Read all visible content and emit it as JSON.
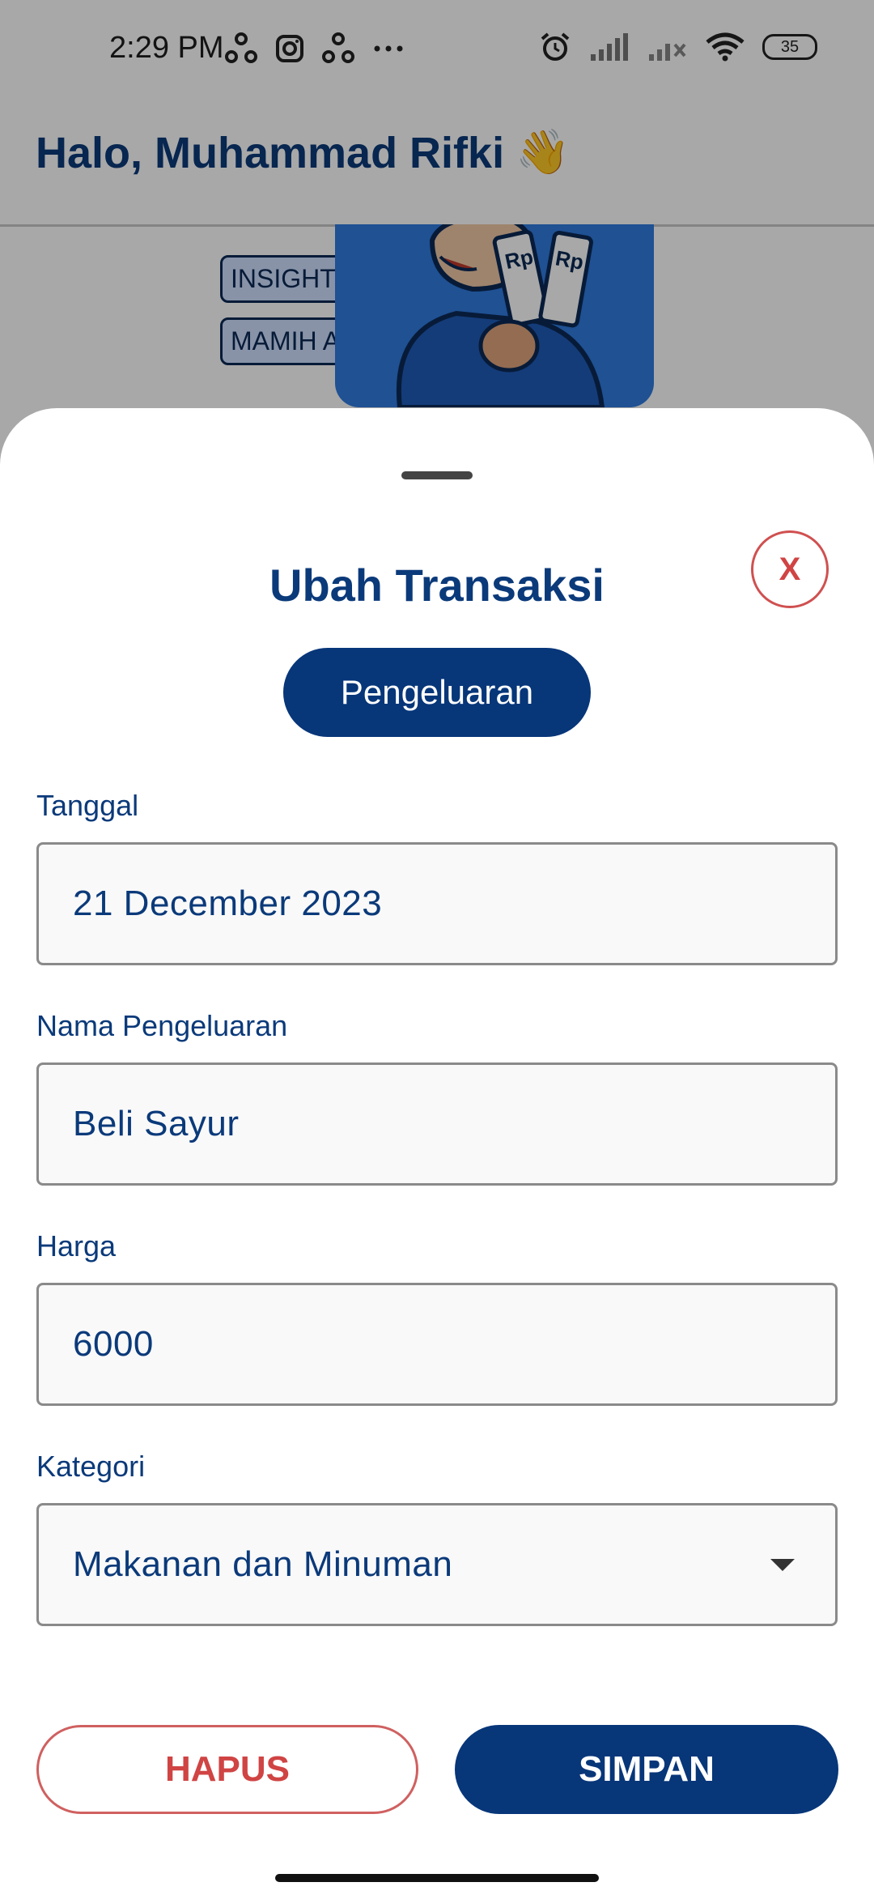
{
  "status_bar": {
    "time": "2:29 PM",
    "battery": "35"
  },
  "header": {
    "greeting": "Halo, Muhammad Rifki",
    "greeting_emoji": "👋"
  },
  "banner": {
    "tag_1": "INSIGHT BY",
    "tag_2": "MAMIH AI",
    "currency_label": "Rp"
  },
  "sheet": {
    "title": "Ubah Transaksi",
    "close_label": "X",
    "type_label": "Pengeluaran",
    "fields": {
      "date": {
        "label": "Tanggal",
        "value": "21 December 2023"
      },
      "name": {
        "label": "Nama Pengeluaran",
        "value": "Beli Sayur"
      },
      "price": {
        "label": "Harga",
        "value": "6000"
      },
      "category": {
        "label": "Kategori",
        "value": "Makanan dan Minuman"
      }
    },
    "delete_label": "HAPUS",
    "save_label": "SIMPAN"
  },
  "colors": {
    "primary": "#073679",
    "danger": "#d04444",
    "text_primary": "#0b3a7a"
  }
}
